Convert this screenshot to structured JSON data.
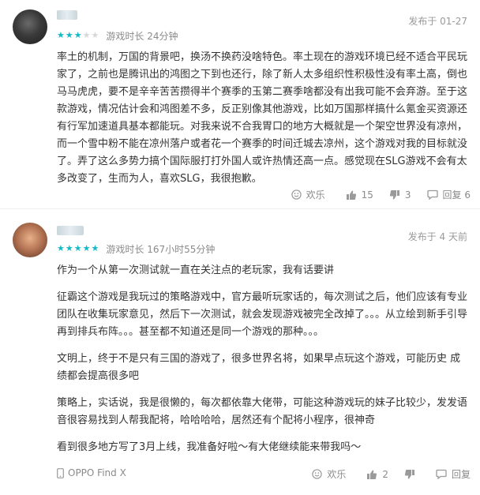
{
  "reviews": [
    {
      "username": "",
      "date": "发布于 01-27",
      "rating": 3,
      "playtime": "游戏时长 24分钟",
      "body": [
        "率土的机制，万国的背景吧，换汤不换药没啥特色。率土现在的游戏环境已经不适合平民玩家了，之前也是腾讯出的鸿图之下到也还行，除了新人太多组织性积极性没有率土高，倒也马马虎虎，要不是辛辛苦苦攒得半个赛季的玉第二赛季啥都没有出我可能不会弃游。至于这款游戏，情况估计会和鸿图差不多，反正别像其他游戏，比如万国那样搞什么氪金买资源还有行军加速道具基本都能玩。对我来说不合我胃口的地方大概就是一个架空世界没有凉州，而一个雪中粉不能在凉州落户或者花一个赛季的时间迁城去凉州，这个游戏对我的目标就没了。弄了这么多势力搞个国际服打打外国人或许热情还高一点。感觉现在SLG游戏不会有太多改变了，生而为人，喜欢SLG，我很抱歉。"
      ],
      "actions": {
        "happy": "欢乐",
        "likes": "15",
        "dislikes": "3",
        "replies": "回复 6"
      }
    },
    {
      "username": "",
      "date": "发布于 4 天前",
      "rating": 5,
      "playtime": "游戏时长 167小时55分钟",
      "body": [
        "作为一个从第一次测试就一直在关注点的老玩家，我有话要讲",
        "征霸这个游戏是我玩过的策略游戏中，官方最听玩家话的，每次测试之后，他们应该有专业团队在收集玩家意见，然后下一次测试，就会发现游戏被完全改掉了。。。从立绘到新手引导再到排兵布阵。。。甚至都不知道还是同一个游戏的那种。。。",
        "文明上，终于不是只有三国的游戏了，很多世界名将，如果早点玩这个游戏，可能历史 成绩都会提高很多吧",
        "策略上，实话说，我是很懒的，每次都依靠大佬带，可能这种游戏玩的妹子比较少，发发语音很容易找到人帮我配将，哈哈哈哈，居然还有个配将小程序，很神奇",
        "看到很多地方写了3月上线，我准备好啦～有大佬继续能来带我吗～"
      ],
      "device": "OPPO Find X",
      "actions": {
        "happy": "欢乐",
        "likes": "2",
        "dislikes": "",
        "replies": "回复"
      }
    }
  ],
  "colors": {
    "accent": "#14b9c8",
    "muted": "#8a8a8a",
    "text": "#333333"
  },
  "icons": [
    "smiley-icon",
    "thumbs-up-icon",
    "thumbs-down-icon",
    "reply-icon",
    "phone-icon",
    "star-icon"
  ]
}
